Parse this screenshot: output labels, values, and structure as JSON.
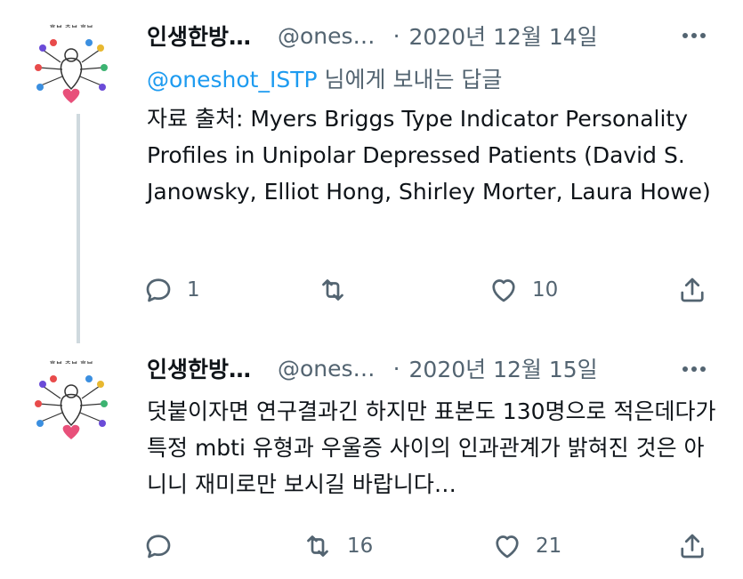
{
  "tweets": [
    {
      "author_name": "인생한방…",
      "handle": "@ones…",
      "dot": "·",
      "date": "2020년 12월 14일",
      "replying_mention": "@oneshot_ISTP",
      "replying_suffix": " 님에게 보내는 답글",
      "text": "자료 출처: Myers Briggs Type Indicator Personality Profiles in Unipolar Depressed Patients (David S. Janowsky, Elliot Hong, Shirley Morter, Laura Howe)",
      "reply_count": "1",
      "retweet_count": "",
      "like_count": "10"
    },
    {
      "author_name": "인생한방…",
      "handle": "@ones…",
      "dot": "·",
      "date": "2020년 12월 15일",
      "text": "덧붙이자면 연구결과긴 하지만 표본도 130명으로 적은데다가 특정 mbti 유형과 우울증 사이의 인과관계가 밝혀진 것은 아니니 재미로만 보시길 바랍니다…",
      "reply_count": "",
      "retweet_count": "16",
      "like_count": "21"
    }
  ],
  "icons": {
    "reply": "reply-icon",
    "retweet": "retweet-icon",
    "like": "heart-icon",
    "share": "share-icon",
    "more": "more-icon"
  },
  "colors": {
    "text": "#0f1419",
    "secondary": "#536471",
    "link": "#1d9bf0",
    "thread_line": "#cfd9de"
  }
}
